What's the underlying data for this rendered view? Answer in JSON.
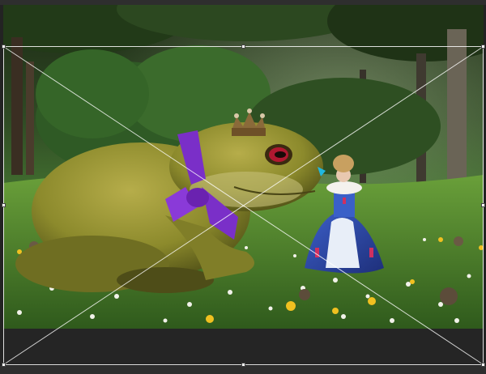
{
  "canvas": {
    "background_color": "#232323",
    "letterbox_color": "#252525",
    "image_subject": "fantasy-frog-princess-photo"
  },
  "crop_tool": {
    "overlay_type": "diagonal",
    "frame_color": "#ffffff",
    "handles": [
      "top-left",
      "top-center",
      "top-right",
      "middle-left",
      "middle-right",
      "bottom-left",
      "bottom-center",
      "bottom-right"
    ]
  }
}
